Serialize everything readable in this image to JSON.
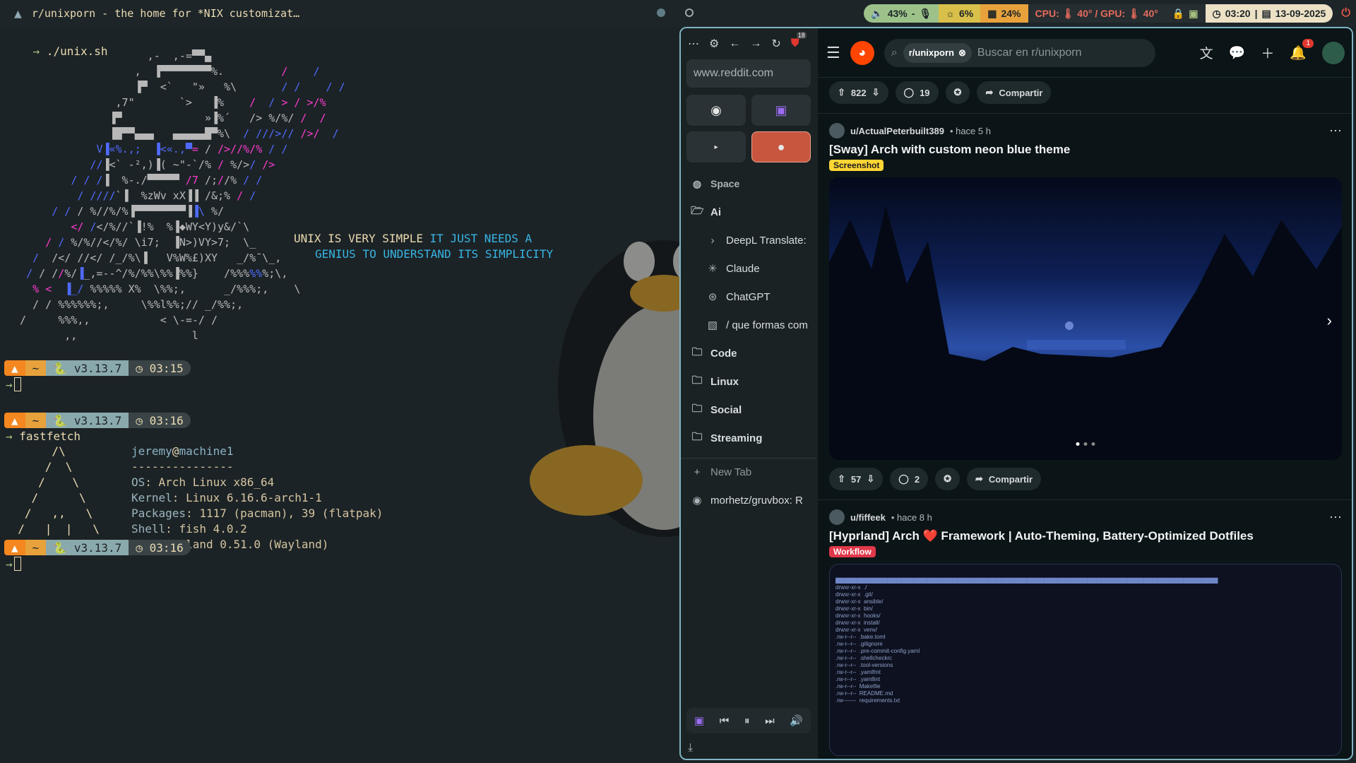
{
  "topbar": {
    "arch_icon": "arch-logo-icon",
    "window_title": "r/unixporn - the home for *NIX customizat…",
    "audio": "43%",
    "mic": "-",
    "brightness": "6%",
    "memory": "24%",
    "temps": "CPU: 🌡 40° / GPU: 🌡 40°",
    "clock_time": "03:20",
    "clock_date": "13-09-2025",
    "power_icon": "power-icon",
    "colors": {
      "audio": "#9cc28a",
      "brightness": "#d9c04a",
      "memory": "#e8a23c",
      "temps": "#e56a5c",
      "clock": "#ece0c5"
    }
  },
  "terminal_top": {
    "command": "./unix.sh",
    "quote_line1_a": "UNIX IS VERY SIMPLE ",
    "quote_line1_b": "IT JUST NEEDS A",
    "quote_line2": "GENIUS TO UNDERSTAND ITS SIMPLICITY",
    "prompt": {
      "os_icon": "arch-icon",
      "dir": "~",
      "python": "v3.13.7",
      "time": "03:15"
    }
  },
  "terminal_bottom": {
    "prompt1": {
      "dir": "~",
      "python": "v3.13.7",
      "time": "03:16"
    },
    "command": "fastfetch",
    "user": "jeremy",
    "host": "machine1",
    "separator": "---------------",
    "info": [
      {
        "key": "OS",
        "value": "Arch Linux x86_64"
      },
      {
        "key": "Kernel",
        "value": "Linux 6.16.6-arch1-1"
      },
      {
        "key": "Packages",
        "value": "1117 (pacman), 39 (flatpak)"
      },
      {
        "key": "Shell",
        "value": "fish 4.0.2"
      },
      {
        "key": "WM",
        "value": "Hyprland 0.51.0 (Wayland)"
      }
    ],
    "prompt2": {
      "dir": "~",
      "python": "v3.13.7",
      "time": "03:16"
    }
  },
  "browser": {
    "sidebar": {
      "url": "www.reddit.com",
      "space_label": "Space",
      "items": [
        {
          "label": "Ai",
          "type": "folder",
          "icon": "folder-icon"
        },
        {
          "label": "DeepL Translate:",
          "type": "sub",
          "icon": "deepl-icon"
        },
        {
          "label": "Claude",
          "type": "sub",
          "icon": "claude-icon"
        },
        {
          "label": "ChatGPT",
          "type": "sub",
          "icon": "chatgpt-icon"
        },
        {
          "label": "/ que formas com",
          "type": "sub",
          "icon": "chat-icon"
        },
        {
          "label": "Code",
          "type": "folder",
          "icon": "folder-icon"
        },
        {
          "label": "Linux",
          "type": "folder",
          "icon": "folder-icon"
        },
        {
          "label": "Social",
          "type": "folder",
          "icon": "folder-icon"
        },
        {
          "label": "Streaming",
          "type": "folder",
          "icon": "folder-icon"
        }
      ],
      "new_tab": "New Tab",
      "bottom_tab": "morhetz/gruvbox: R",
      "ublock_badge": "18"
    },
    "reddit": {
      "subreddit": "r/unixporn",
      "search_placeholder": "Buscar en r/unixporn",
      "notif_count": "1",
      "post0_actions": {
        "votes": "822",
        "comments": "19",
        "share": "Compartir"
      },
      "post1": {
        "user": "u/ActualPeterbuilt389",
        "time": "• hace 5 h",
        "title": "[Sway] Arch with custom neon blue theme",
        "flair": "Screenshot",
        "votes": "57",
        "comments": "2",
        "share": "Compartir"
      },
      "post2": {
        "user": "u/fiffeek",
        "time": "• hace 8 h",
        "title": "[Hyprland] Arch ❤️ Framework | Auto-Theming, Battery-Optimized Dotfiles",
        "flair": "Workflow"
      }
    }
  }
}
